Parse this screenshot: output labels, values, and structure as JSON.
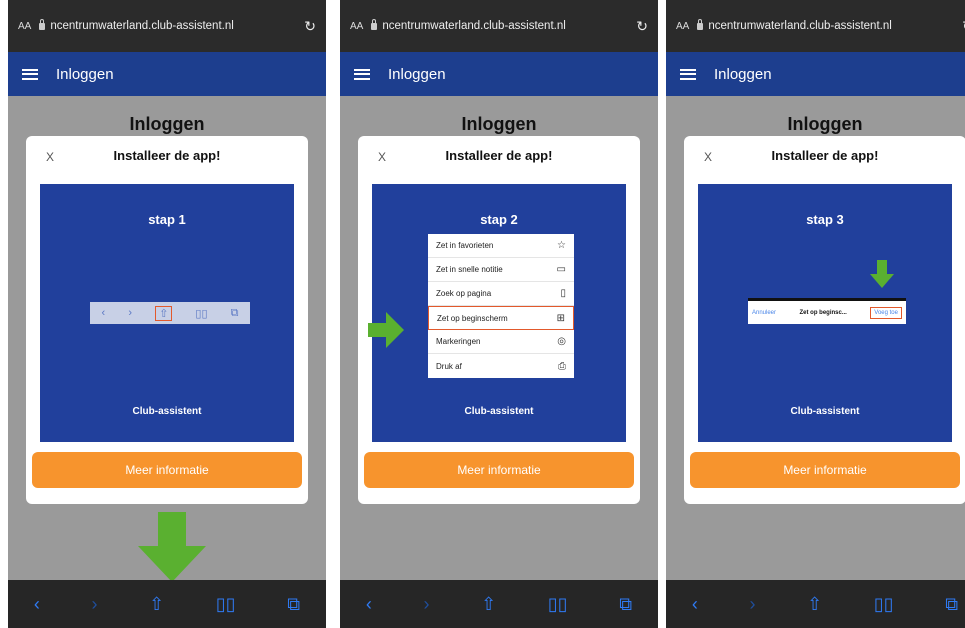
{
  "browser": {
    "aa": "AA",
    "url": "ncentrumwaterland.club-assistent.nl",
    "reload_icon": "reload-icon"
  },
  "nav": {
    "title": "Inloggen"
  },
  "page": {
    "title": "Inloggen"
  },
  "modal": {
    "close": "X",
    "title": "Installeer de app!",
    "button": "Meer informatie",
    "footer": "Club-assistent"
  },
  "steps": [
    "stap 1",
    "stap 2",
    "stap 3"
  ],
  "step2_menu": [
    {
      "label": "Zet in favorieten",
      "icon": "☆"
    },
    {
      "label": "Zet in snelle notitie",
      "icon": "▭"
    },
    {
      "label": "Zoek op pagina",
      "icon": "▯"
    },
    {
      "label": "Zet op beginscherm",
      "icon": "⊞",
      "selected": true
    },
    {
      "label": "Markeringen",
      "icon": "◎"
    },
    {
      "label": "Druk af",
      "icon": "⎙"
    }
  ],
  "step3_dialog": {
    "cancel": "Annuleer",
    "middle": "Zet op beginsc...",
    "add": "Voeg toe"
  },
  "toolbar_icons": {
    "back": "‹",
    "forward": "›",
    "share": "⇧",
    "bookmarks": "📖",
    "tabs": "⧉"
  },
  "colors": {
    "nav": "#1d3e8e",
    "panel": "#21409c",
    "cta": "#f7942d",
    "arrow": "#5ab030",
    "highlight": "#e2592c"
  }
}
